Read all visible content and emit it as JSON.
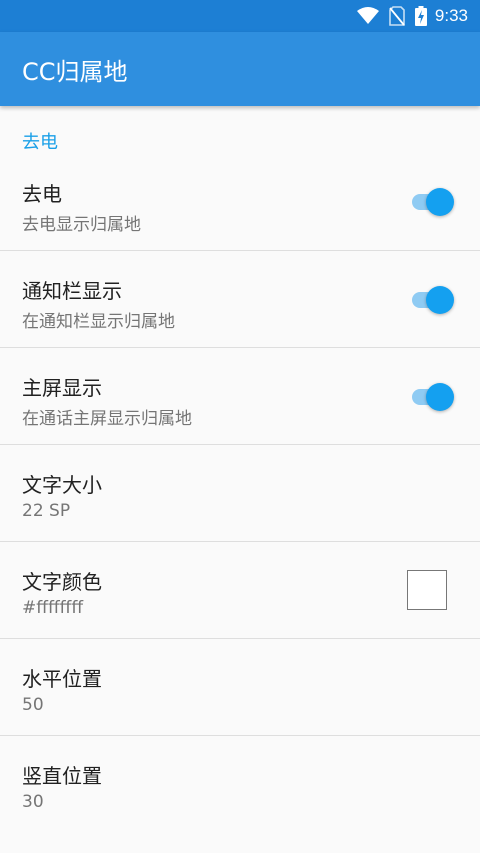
{
  "status_bar": {
    "time": "9:33",
    "icons": [
      "wifi-icon",
      "no-sim-icon",
      "battery-charging-icon"
    ]
  },
  "app_bar": {
    "title": "CC归属地"
  },
  "category": {
    "label": "去电"
  },
  "prefs": [
    {
      "title": "去电",
      "summary": "去电显示归属地",
      "widget": "switch",
      "checked": true
    },
    {
      "title": "通知栏显示",
      "summary": "在通知栏显示归属地",
      "widget": "switch",
      "checked": true
    },
    {
      "title": "主屏显示",
      "summary": "在通话主屏显示归属地",
      "widget": "switch",
      "checked": true
    },
    {
      "title": "文字大小",
      "summary": "22 SP"
    },
    {
      "title": "文字颜色",
      "summary": "#ffffffff",
      "widget": "color",
      "color": "#ffffff"
    },
    {
      "title": "水平位置",
      "summary": "50"
    },
    {
      "title": "竖直位置",
      "summary": "30"
    }
  ],
  "colors": {
    "status_bar": "#1d7fd4",
    "app_bar": "#2f8fdf",
    "accent": "#14a0f0"
  }
}
